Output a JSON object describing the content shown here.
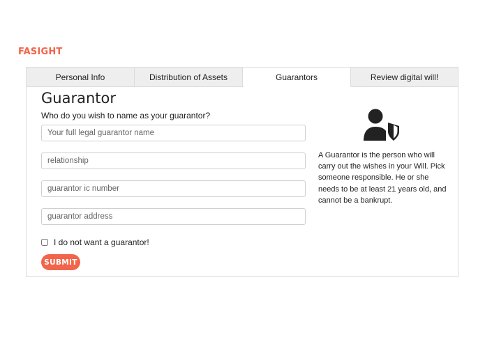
{
  "brand": "FASIGHT",
  "tabs": [
    {
      "label": "Personal Info",
      "active": false
    },
    {
      "label": "Distribution of Assets",
      "active": false
    },
    {
      "label": "Guarantors",
      "active": true
    },
    {
      "label": "Review digital will!",
      "active": false
    }
  ],
  "form": {
    "title": "Guarantor",
    "question": "Who do you wish to name as your guarantor?",
    "fields": [
      {
        "placeholder": "Your full legal guarantor name",
        "value": ""
      },
      {
        "placeholder": "relationship",
        "value": ""
      },
      {
        "placeholder": "guarantor ic number",
        "value": ""
      },
      {
        "placeholder": "guarantor address",
        "value": ""
      }
    ],
    "no_guarantor_label": "I do not want a guarantor!",
    "no_guarantor_checked": false,
    "submit_label": "SUBMIT"
  },
  "info": {
    "icon": "person-shield-icon",
    "text": "A Guarantor is the person who will carry out the wishes in your Will. Pick someone responsible. He or she needs to be at least 21 years old, and cannot be a bankrupt."
  },
  "colors": {
    "accent": "#f2654a",
    "tab_inactive_bg": "#eeeeee",
    "border": "#dcdcdc",
    "icon": "#222222"
  }
}
